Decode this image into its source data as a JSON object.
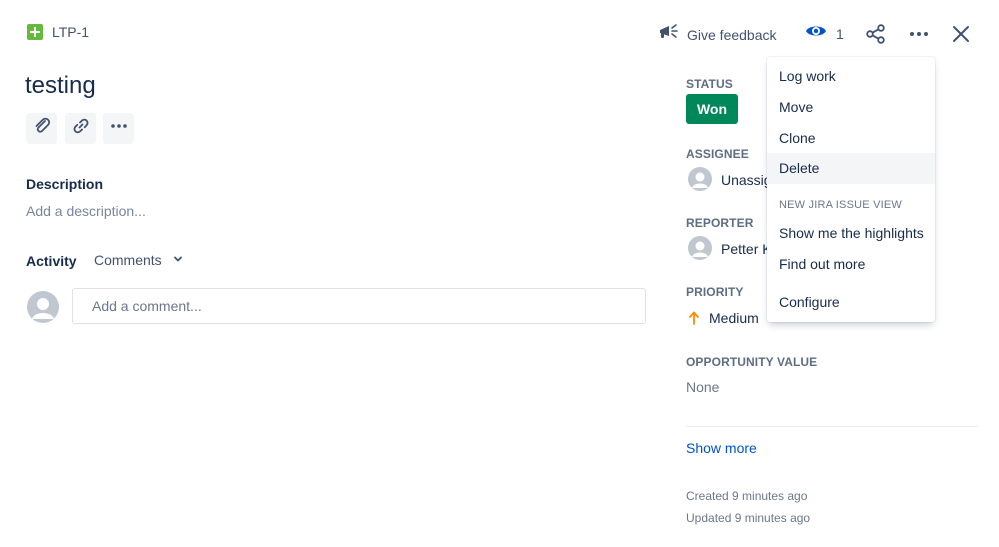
{
  "issue": {
    "key": "LTP-1",
    "title": "testing"
  },
  "header": {
    "feedback_label": "Give feedback",
    "watch_count": "1"
  },
  "description": {
    "label": "Description",
    "placeholder": "Add a description..."
  },
  "activity": {
    "label": "Activity",
    "filter_value": "Comments",
    "comment_placeholder": "Add a comment..."
  },
  "fields": {
    "status_label": "STATUS",
    "status_value": "Won",
    "status_color": "#00875a",
    "assignee_label": "ASSIGNEE",
    "assignee_value": "Unassig",
    "reporter_label": "REPORTER",
    "reporter_value": "Petter K",
    "priority_label": "PRIORITY",
    "priority_value": "Medium",
    "opportunity_label": "OPPORTUNITY VALUE",
    "opportunity_value": "None",
    "show_more": "Show more",
    "created": "Created 9 minutes ago",
    "updated": "Updated 9 minutes ago"
  },
  "menu": {
    "items": [
      "Log work",
      "Move",
      "Clone",
      "Delete"
    ],
    "section_heading": "NEW JIRA ISSUE VIEW",
    "section_items": [
      "Show me the highlights",
      "Find out more"
    ],
    "configure": "Configure"
  },
  "colors": {
    "text": "#172b4d",
    "link": "#0052cc",
    "story": "#63ba3c",
    "priority_medium": "#ff8b00",
    "watch_icon": "#0052cc"
  }
}
